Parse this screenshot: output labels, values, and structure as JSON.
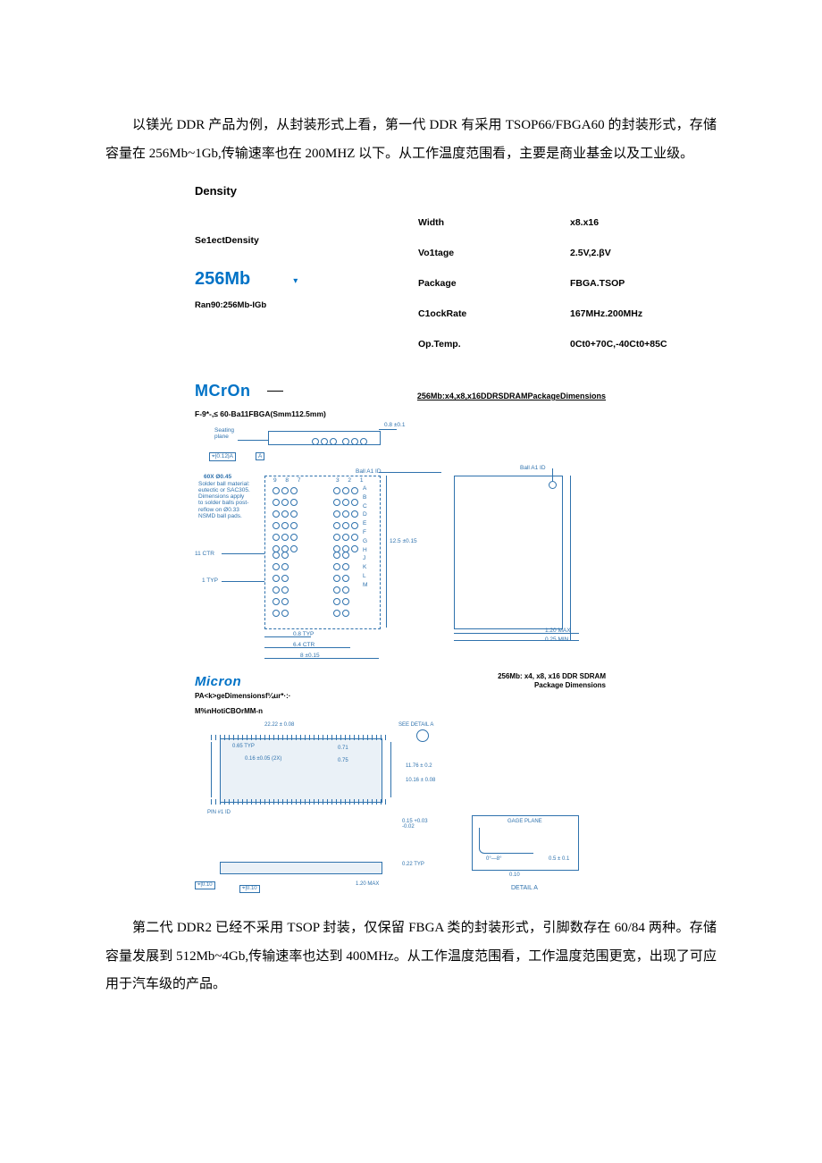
{
  "para1": "以镁光 DDR 产品为例，从封装形式上看，第一代 DDR 有采用 TSOP66/FBGA60 的封装形式，存储容量在 256Mb~1Gb,传输速率也在 200MHZ 以下。从工作温度范围看，主要是商业基金以及工业级。",
  "spec": {
    "density_title": "Density",
    "select_label": "Se1ectDensity",
    "value": "256Mb",
    "range": "Ran90:256Mb-IGb",
    "rows": [
      {
        "k": "Width",
        "v": "x8.x16"
      },
      {
        "k": "Vo1tage",
        "v": "2.5V,2.βV"
      },
      {
        "k": "Package",
        "v": "FBGA.TSOP"
      },
      {
        "k": "C1ockRate",
        "v": "167MHz.200MHz"
      },
      {
        "k": "Op.Temp.",
        "v": "0Ct0+70C,-40Ct0+85C"
      }
    ]
  },
  "diag1": {
    "logo": "MCrOn",
    "title": "256Mb:x4,x8,x16DDRSDRAMPackageDimensions",
    "sub": "F-9*-,≤ 60-Ba11FBGA(Smm112.5mm)",
    "labels": {
      "seating": "Seating\nplane",
      "gdt": "⌖|0.12|A",
      "a_box": "A",
      "tr_tol": "0.8 ±0.1",
      "sixtyx": "60X Ø0.45",
      "notes": "Solder ball material:\neutectic or SAC305.\nDimensions apply\nto solder balls post-\nreflow on Ø0.33\nNSMD ball pads.",
      "balla1": "Ball A1 ID",
      "balla1_r": "Ball A1 ID",
      "rowlbls": "A\nB\nC\nD\nE\nF\nG\nH\nJ\nK\nL\nM",
      "col987": "9 8 7",
      "col321": "3 2 1",
      "ctr11": "11 CTR",
      "typ1": "1 TYP",
      "dim_h": "12.5 ±0.15",
      "dim_08": "0.8 TYP",
      "dim_64": "6.4 CTR",
      "dim_8": "8 ±0.15",
      "dim_120": "1.20 MAX",
      "dim_025": "0.25 MIN"
    }
  },
  "diag2": {
    "logo": "Micron",
    "title": "256Mb: x4, x8, x16 DDR SDRAM\nPackage Dimensions",
    "sub1": "PA<k>geDimensionsf¼ur*·:·",
    "sub2": "M%nHotiCBOrMM-n",
    "labels": {
      "d1": "22.22 ± 0.08",
      "d2": "0.65 TYP",
      "d3": "SEE DETAIL A",
      "d4": "0.16 ±0.05 (2X)",
      "d5": "0.71",
      "d6": "0.75",
      "d7": "11.76 ± 0.2",
      "d8": "10.16 ± 0.08",
      "d9": "PIN #1 ID",
      "d10": "0.15 +0.03\n-0.02",
      "d11": "GAGE PLANE",
      "d12": "0°—8°",
      "d13": "0.10",
      "d14": "0.5 ± 0.1",
      "d15": "0.22 TYP",
      "d16": "1.20 MAX",
      "d17": "DETAIL A"
    }
  },
  "para2": "第二代 DDR2 已经不采用 TSOP 封装，仅保留 FBGA 类的封装形式，引脚数存在 60/84 两种。存储容量发展到 512Mb~4Gb,传输速率也达到 400MHz。从工作温度范围看，工作温度范围更宽，出现了可应用于汽车级的产品。"
}
